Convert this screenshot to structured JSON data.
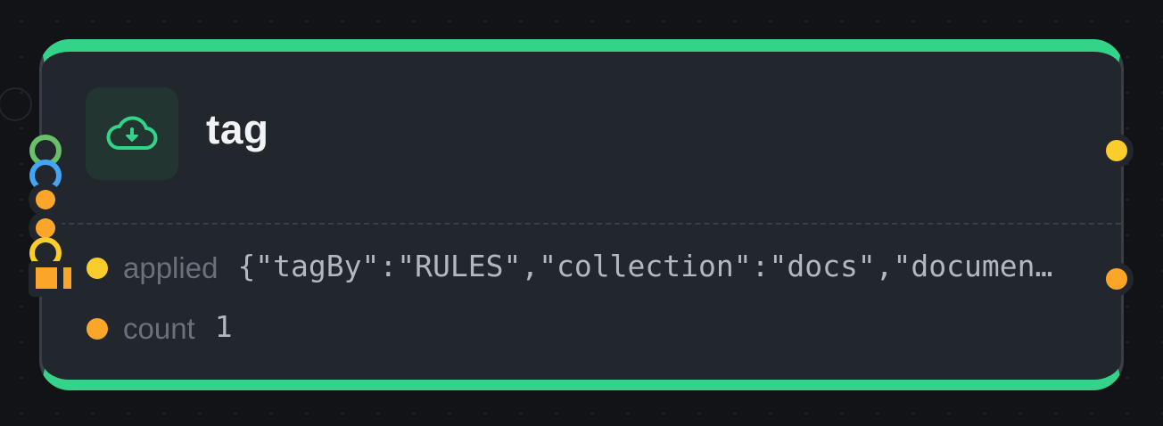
{
  "node": {
    "title": "tag",
    "icon": "cloud-download-icon",
    "accent_color": "#34d38a",
    "fields": [
      {
        "label": "applied",
        "value": "{\"tagBy\":\"RULES\",\"collection\":\"docs\",\"documents\":[],\"tags\":[]}",
        "dot_color": "#fccb2c"
      },
      {
        "label": "count",
        "value": "1",
        "dot_color": "#fba629"
      }
    ]
  },
  "handles": {
    "inputs": [
      {
        "name": "green-ring",
        "color": "#6abf69"
      },
      {
        "name": "blue-ring",
        "color": "#42a5f5"
      },
      {
        "name": "orange-dot-1",
        "color": "#fba629"
      },
      {
        "name": "orange-dot-2",
        "color": "#fba629"
      },
      {
        "name": "yellow-ring",
        "color": "#fccb2c"
      },
      {
        "name": "orange-square",
        "color": "#fba629"
      }
    ],
    "outputs": [
      {
        "name": "yellow",
        "color": "#fccb2c"
      },
      {
        "name": "orange",
        "color": "#fba629"
      }
    ]
  }
}
